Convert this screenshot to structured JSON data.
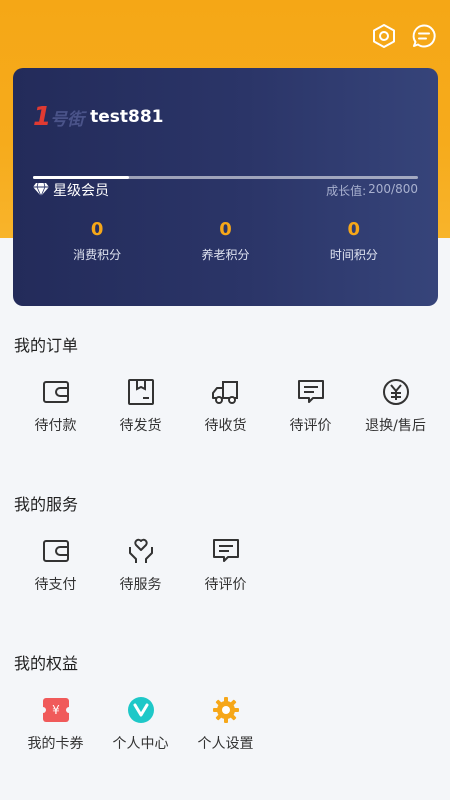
{
  "header": {
    "icons": [
      "settings-hex-icon",
      "message-icon"
    ]
  },
  "member_card": {
    "brand_logo_text": "1号街",
    "username": "test881",
    "level_label": "星级会员",
    "growth_label": "成长值:",
    "growth_value": "200/800",
    "growth_progress": 0.25,
    "points": [
      {
        "value": "0",
        "label": "消费积分"
      },
      {
        "value": "0",
        "label": "养老积分"
      },
      {
        "value": "0",
        "label": "时间积分"
      }
    ]
  },
  "orders": {
    "title": "我的订单",
    "items": [
      {
        "label": "待付款",
        "icon": "wallet-icon"
      },
      {
        "label": "待发货",
        "icon": "package-icon"
      },
      {
        "label": "待收货",
        "icon": "truck-icon"
      },
      {
        "label": "待评价",
        "icon": "comment-icon"
      },
      {
        "label": "退换/售后",
        "icon": "yen-refund-icon"
      }
    ]
  },
  "services": {
    "title": "我的服务",
    "items": [
      {
        "label": "待支付",
        "icon": "wallet-icon"
      },
      {
        "label": "待服务",
        "icon": "heart-hand-icon"
      },
      {
        "label": "待评价",
        "icon": "comment-icon"
      }
    ]
  },
  "benefits": {
    "title": "我的权益",
    "items": [
      {
        "label": "我的卡券",
        "icon": "coupon-icon"
      },
      {
        "label": "个人中心",
        "icon": "v-badge-icon"
      },
      {
        "label": "个人设置",
        "icon": "gear-icon"
      }
    ]
  },
  "colors": {
    "header_orange": "#f5a716",
    "card_navy": "#232b5a",
    "points_orange": "#f6a719",
    "coupon_red": "#f05a5a",
    "teal": "#1ec8c8",
    "gear_orange": "#f6a719"
  }
}
